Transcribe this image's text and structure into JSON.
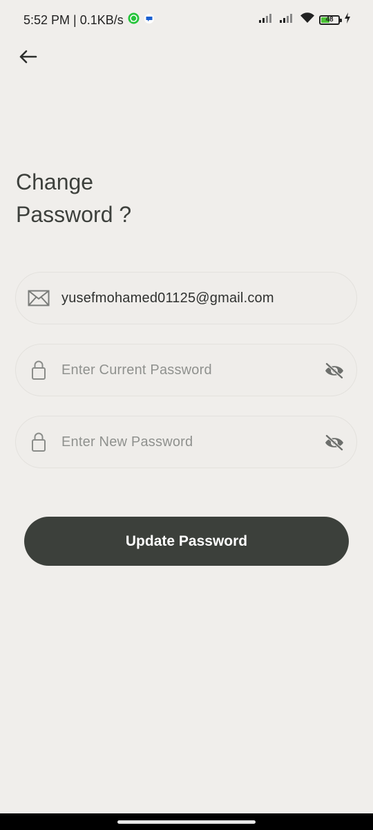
{
  "status_bar": {
    "time_speed": "5:52 PM | 0.1KB/s",
    "battery_level": "48"
  },
  "header": {
    "back_icon": "arrow-left-icon"
  },
  "title": {
    "line1": "Change",
    "line2": "Password ?"
  },
  "form": {
    "email": {
      "icon": "mail-icon",
      "value": "yusefmohamed01125@gmail.com"
    },
    "current_password": {
      "icon": "lock-icon",
      "placeholder": "Enter Current Password",
      "toggle_icon": "eye-off-icon"
    },
    "new_password": {
      "icon": "lock-icon",
      "placeholder": "Enter New Password",
      "toggle_icon": "eye-off-icon"
    }
  },
  "submit": {
    "label": "Update Password"
  },
  "colors": {
    "background": "#f0eeeb",
    "button": "#3c403b",
    "text": "#3d403c",
    "placeholder": "#8f918e"
  }
}
